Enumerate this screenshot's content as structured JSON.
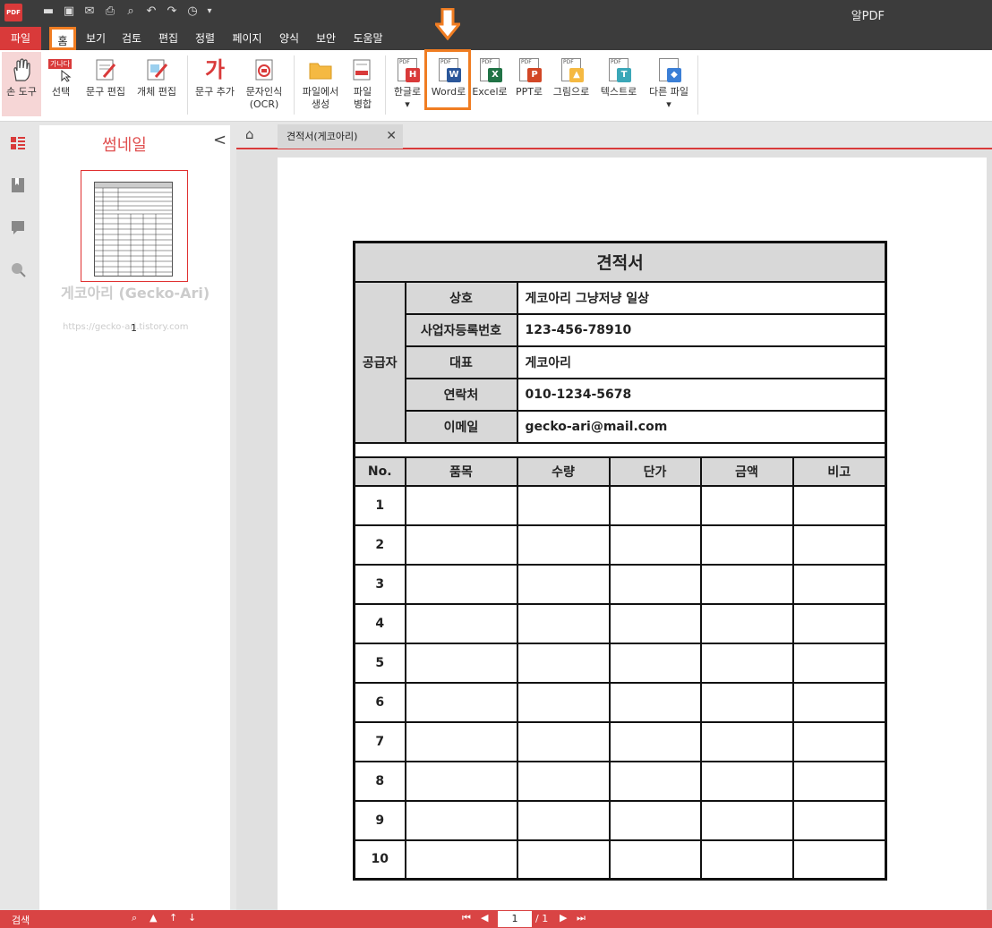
{
  "app": {
    "title": "알PDF",
    "logo_text": "PDF"
  },
  "menu": {
    "items": [
      {
        "label": "파일"
      },
      {
        "label": "홈"
      },
      {
        "label": "보기"
      },
      {
        "label": "검토"
      },
      {
        "label": "편집"
      },
      {
        "label": "정렬"
      },
      {
        "label": "페이지"
      },
      {
        "label": "양식"
      },
      {
        "label": "보안"
      },
      {
        "label": "도움말"
      }
    ]
  },
  "ribbon": {
    "hand": "손 도구",
    "select": "선택",
    "select_tag": "가나다",
    "text_edit": "문구 편집",
    "object_edit": "개체 편집",
    "text_add": "문구 추가",
    "text_add_glyph": "가",
    "ocr_line1": "문자인식",
    "ocr_line2": "(OCR)",
    "from_file_line1": "파일에서",
    "from_file_line2": "생성",
    "merge_line1": "파일",
    "merge_line2": "병합",
    "to_hwp": "한글로",
    "to_word": "Word로",
    "to_excel": "Excel로",
    "to_ppt": "PPT로",
    "to_image": "그림으로",
    "to_text": "텍스트로",
    "to_other": "다른 파일",
    "pdf_tag": "PDF",
    "hwp_badge": "H",
    "word_badge": "W",
    "excel_badge": "X",
    "ppt_badge": "P",
    "text_badge": "T"
  },
  "thumbnail": {
    "title": "썸네일",
    "page_number": "1",
    "watermark": "게코아리 (Gecko-Ari)",
    "watermark_url": "https://gecko-ari.tistory.com"
  },
  "tabs": {
    "doc_tab": "견적서(게코아리)"
  },
  "quote": {
    "title": "견적서",
    "supplier_label": "공급자",
    "rows": [
      {
        "label": "상호",
        "value": "게코아리 그냥저냥 일상"
      },
      {
        "label": "사업자등록번호",
        "value": "123-456-78910"
      },
      {
        "label": "대표",
        "value": "게코아리"
      },
      {
        "label": "연락처",
        "value": "010-1234-5678"
      },
      {
        "label": "이메일",
        "value": "gecko-ari@mail.com"
      }
    ],
    "headers": [
      "No.",
      "품목",
      "수량",
      "단가",
      "금액",
      "비고"
    ],
    "numbers": [
      "1",
      "2",
      "3",
      "4",
      "5",
      "6",
      "7",
      "8",
      "9",
      "10"
    ]
  },
  "status": {
    "search_label": "검색",
    "current_page": "1",
    "total_pages": "/ 1"
  },
  "colors": {
    "accent": "#d93a3a",
    "highlight": "#f07d22"
  }
}
